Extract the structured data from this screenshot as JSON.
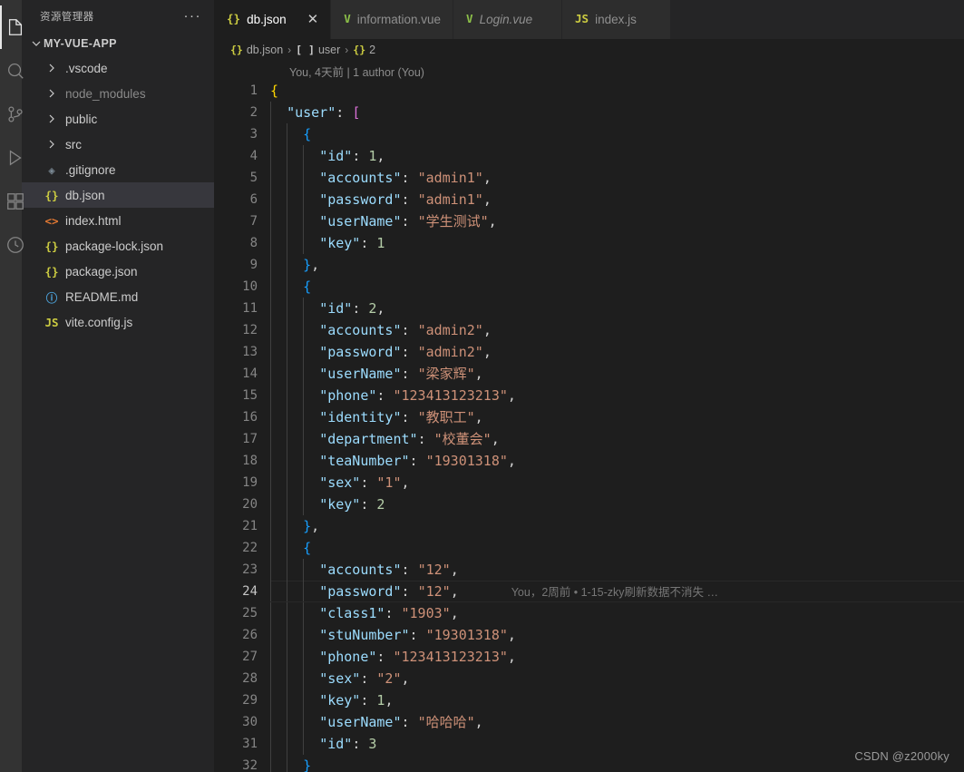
{
  "colors": {
    "editor_bg": "#1e1e1e",
    "sidebar_bg": "#252526",
    "activitybar_bg": "#333333",
    "tab_active_bg": "#1e1e1e",
    "tab_inactive_bg": "#2d2d2d",
    "selection_bg": "#37373d",
    "key": "#9cdcfe",
    "string": "#ce9178",
    "number": "#b5cea8",
    "bracket_gold": "#ffd700",
    "bracket_pink": "#da70d6",
    "bracket_blue": "#179fff"
  },
  "activity_bar": {
    "items": [
      {
        "name": "explorer-icon",
        "active": true
      },
      {
        "name": "search-icon",
        "active": false
      },
      {
        "name": "source-control-icon",
        "active": false
      },
      {
        "name": "run-debug-icon",
        "active": false
      },
      {
        "name": "extensions-icon",
        "active": false
      },
      {
        "name": "remote-explorer-icon",
        "active": false
      }
    ]
  },
  "sidebar": {
    "title": "资源管理器",
    "more_label": "···",
    "root_folder": "MY-VUE-APP",
    "items": [
      {
        "label": ".vscode",
        "icon": "chevron-right",
        "icon_text": "",
        "icon_color": "#cccccc",
        "kind": "folder",
        "dim": false,
        "selected": false
      },
      {
        "label": "node_modules",
        "icon": "chevron-right",
        "icon_text": "",
        "icon_color": "#cccccc",
        "kind": "folder",
        "dim": true,
        "selected": false
      },
      {
        "label": "public",
        "icon": "chevron-right",
        "icon_text": "",
        "icon_color": "#cccccc",
        "kind": "folder",
        "dim": false,
        "selected": false
      },
      {
        "label": "src",
        "icon": "chevron-right",
        "icon_text": "",
        "icon_color": "#cccccc",
        "kind": "folder",
        "dim": false,
        "selected": false
      },
      {
        "label": ".gitignore",
        "icon": "git-icon",
        "icon_text": "◈",
        "icon_color": "#7b8a95",
        "kind": "file",
        "dim": false,
        "selected": false
      },
      {
        "label": "db.json",
        "icon": "json-icon",
        "icon_text": "{}",
        "icon_color": "#cbcb41",
        "kind": "file",
        "dim": false,
        "selected": true
      },
      {
        "label": "index.html",
        "icon": "html-icon",
        "icon_text": "<>",
        "icon_color": "#e37933",
        "kind": "file",
        "dim": false,
        "selected": false
      },
      {
        "label": "package-lock.json",
        "icon": "json-icon",
        "icon_text": "{}",
        "icon_color": "#cbcb41",
        "kind": "file",
        "dim": false,
        "selected": false
      },
      {
        "label": "package.json",
        "icon": "json-icon",
        "icon_text": "{}",
        "icon_color": "#cbcb41",
        "kind": "file",
        "dim": false,
        "selected": false
      },
      {
        "label": "README.md",
        "icon": "info-icon",
        "icon_text": "ⓘ",
        "icon_color": "#4b9fd5",
        "kind": "file",
        "dim": false,
        "selected": false
      },
      {
        "label": "vite.config.js",
        "icon": "js-icon",
        "icon_text": "JS",
        "icon_color": "#cbcb41",
        "kind": "file",
        "dim": false,
        "selected": false
      }
    ]
  },
  "tabs": [
    {
      "label": "db.json",
      "icon_text": "{}",
      "icon_color": "#cbcb41",
      "icon_name": "json-icon",
      "active": true,
      "italic": false,
      "close": "✕"
    },
    {
      "label": "information.vue",
      "icon_text": "V",
      "icon_color": "#8dc149",
      "icon_name": "vue-icon",
      "active": false,
      "italic": false,
      "close": ""
    },
    {
      "label": "Login.vue",
      "icon_text": "V",
      "icon_color": "#8dc149",
      "icon_name": "vue-icon",
      "active": false,
      "italic": true,
      "close": ""
    },
    {
      "label": "index.js",
      "icon_text": "JS",
      "icon_color": "#cbcb41",
      "icon_name": "js-icon",
      "active": false,
      "italic": false,
      "close": ""
    }
  ],
  "breadcrumb": [
    {
      "icon_text": "{}",
      "icon_color": "#cbcb41",
      "icon_name": "json-icon",
      "label": "db.json"
    },
    {
      "icon_text": "[ ]",
      "icon_color": "#cccccc",
      "icon_name": "array-icon",
      "label": "user"
    },
    {
      "icon_text": "{}",
      "icon_color": "#cbcb41",
      "icon_name": "object-icon",
      "label": "2"
    }
  ],
  "breadcrumb_sep": "›",
  "blame_header": "You, 4天前 | 1 author (You)",
  "inline_blame": "You，2周前 • 1-15-zky刷新数据不消失 …",
  "watermark": "CSDN @z2000ky",
  "code": {
    "active_line": 24,
    "lines": [
      {
        "no": 1,
        "tokens": [
          {
            "t": "{",
            "c": "b0"
          }
        ]
      },
      {
        "no": 2,
        "tokens": [
          {
            "t": "  ",
            "c": "p"
          },
          {
            "t": "\"user\"",
            "c": "k"
          },
          {
            "t": ": ",
            "c": "p"
          },
          {
            "t": "[",
            "c": "b1"
          }
        ]
      },
      {
        "no": 3,
        "tokens": [
          {
            "t": "    ",
            "c": "p"
          },
          {
            "t": "{",
            "c": "b2"
          }
        ]
      },
      {
        "no": 4,
        "tokens": [
          {
            "t": "      ",
            "c": "p"
          },
          {
            "t": "\"id\"",
            "c": "k"
          },
          {
            "t": ": ",
            "c": "p"
          },
          {
            "t": "1",
            "c": "n"
          },
          {
            "t": ",",
            "c": "p"
          }
        ]
      },
      {
        "no": 5,
        "tokens": [
          {
            "t": "      ",
            "c": "p"
          },
          {
            "t": "\"accounts\"",
            "c": "k"
          },
          {
            "t": ": ",
            "c": "p"
          },
          {
            "t": "\"admin1\"",
            "c": "s"
          },
          {
            "t": ",",
            "c": "p"
          }
        ]
      },
      {
        "no": 6,
        "tokens": [
          {
            "t": "      ",
            "c": "p"
          },
          {
            "t": "\"password\"",
            "c": "k"
          },
          {
            "t": ": ",
            "c": "p"
          },
          {
            "t": "\"admin1\"",
            "c": "s"
          },
          {
            "t": ",",
            "c": "p"
          }
        ]
      },
      {
        "no": 7,
        "tokens": [
          {
            "t": "      ",
            "c": "p"
          },
          {
            "t": "\"userName\"",
            "c": "k"
          },
          {
            "t": ": ",
            "c": "p"
          },
          {
            "t": "\"学生测试\"",
            "c": "s"
          },
          {
            "t": ",",
            "c": "p"
          }
        ]
      },
      {
        "no": 8,
        "tokens": [
          {
            "t": "      ",
            "c": "p"
          },
          {
            "t": "\"key\"",
            "c": "k"
          },
          {
            "t": ": ",
            "c": "p"
          },
          {
            "t": "1",
            "c": "n"
          }
        ]
      },
      {
        "no": 9,
        "tokens": [
          {
            "t": "    ",
            "c": "p"
          },
          {
            "t": "}",
            "c": "b2"
          },
          {
            "t": ",",
            "c": "p"
          }
        ]
      },
      {
        "no": 10,
        "tokens": [
          {
            "t": "    ",
            "c": "p"
          },
          {
            "t": "{",
            "c": "b2"
          }
        ]
      },
      {
        "no": 11,
        "tokens": [
          {
            "t": "      ",
            "c": "p"
          },
          {
            "t": "\"id\"",
            "c": "k"
          },
          {
            "t": ": ",
            "c": "p"
          },
          {
            "t": "2",
            "c": "n"
          },
          {
            "t": ",",
            "c": "p"
          }
        ]
      },
      {
        "no": 12,
        "tokens": [
          {
            "t": "      ",
            "c": "p"
          },
          {
            "t": "\"accounts\"",
            "c": "k"
          },
          {
            "t": ": ",
            "c": "p"
          },
          {
            "t": "\"admin2\"",
            "c": "s"
          },
          {
            "t": ",",
            "c": "p"
          }
        ]
      },
      {
        "no": 13,
        "tokens": [
          {
            "t": "      ",
            "c": "p"
          },
          {
            "t": "\"password\"",
            "c": "k"
          },
          {
            "t": ": ",
            "c": "p"
          },
          {
            "t": "\"admin2\"",
            "c": "s"
          },
          {
            "t": ",",
            "c": "p"
          }
        ]
      },
      {
        "no": 14,
        "tokens": [
          {
            "t": "      ",
            "c": "p"
          },
          {
            "t": "\"userName\"",
            "c": "k"
          },
          {
            "t": ": ",
            "c": "p"
          },
          {
            "t": "\"梁家辉\"",
            "c": "s"
          },
          {
            "t": ",",
            "c": "p"
          }
        ]
      },
      {
        "no": 15,
        "tokens": [
          {
            "t": "      ",
            "c": "p"
          },
          {
            "t": "\"phone\"",
            "c": "k"
          },
          {
            "t": ": ",
            "c": "p"
          },
          {
            "t": "\"123413123213\"",
            "c": "s"
          },
          {
            "t": ",",
            "c": "p"
          }
        ]
      },
      {
        "no": 16,
        "tokens": [
          {
            "t": "      ",
            "c": "p"
          },
          {
            "t": "\"identity\"",
            "c": "k"
          },
          {
            "t": ": ",
            "c": "p"
          },
          {
            "t": "\"教职工\"",
            "c": "s"
          },
          {
            "t": ",",
            "c": "p"
          }
        ]
      },
      {
        "no": 17,
        "tokens": [
          {
            "t": "      ",
            "c": "p"
          },
          {
            "t": "\"department\"",
            "c": "k"
          },
          {
            "t": ": ",
            "c": "p"
          },
          {
            "t": "\"校董会\"",
            "c": "s"
          },
          {
            "t": ",",
            "c": "p"
          }
        ]
      },
      {
        "no": 18,
        "tokens": [
          {
            "t": "      ",
            "c": "p"
          },
          {
            "t": "\"teaNumber\"",
            "c": "k"
          },
          {
            "t": ": ",
            "c": "p"
          },
          {
            "t": "\"19301318\"",
            "c": "s"
          },
          {
            "t": ",",
            "c": "p"
          }
        ]
      },
      {
        "no": 19,
        "tokens": [
          {
            "t": "      ",
            "c": "p"
          },
          {
            "t": "\"sex\"",
            "c": "k"
          },
          {
            "t": ": ",
            "c": "p"
          },
          {
            "t": "\"1\"",
            "c": "s"
          },
          {
            "t": ",",
            "c": "p"
          }
        ]
      },
      {
        "no": 20,
        "tokens": [
          {
            "t": "      ",
            "c": "p"
          },
          {
            "t": "\"key\"",
            "c": "k"
          },
          {
            "t": ": ",
            "c": "p"
          },
          {
            "t": "2",
            "c": "n"
          }
        ]
      },
      {
        "no": 21,
        "tokens": [
          {
            "t": "    ",
            "c": "p"
          },
          {
            "t": "}",
            "c": "b2"
          },
          {
            "t": ",",
            "c": "p"
          }
        ]
      },
      {
        "no": 22,
        "tokens": [
          {
            "t": "    ",
            "c": "p"
          },
          {
            "t": "{",
            "c": "b2"
          }
        ]
      },
      {
        "no": 23,
        "tokens": [
          {
            "t": "      ",
            "c": "p"
          },
          {
            "t": "\"accounts\"",
            "c": "k"
          },
          {
            "t": ": ",
            "c": "p"
          },
          {
            "t": "\"12\"",
            "c": "s"
          },
          {
            "t": ",",
            "c": "p"
          }
        ]
      },
      {
        "no": 24,
        "tokens": [
          {
            "t": "      ",
            "c": "p"
          },
          {
            "t": "\"password\"",
            "c": "k"
          },
          {
            "t": ": ",
            "c": "p"
          },
          {
            "t": "\"12\"",
            "c": "s"
          },
          {
            "t": ",",
            "c": "p"
          }
        ]
      },
      {
        "no": 25,
        "tokens": [
          {
            "t": "      ",
            "c": "p"
          },
          {
            "t": "\"class1\"",
            "c": "k"
          },
          {
            "t": ": ",
            "c": "p"
          },
          {
            "t": "\"1903\"",
            "c": "s"
          },
          {
            "t": ",",
            "c": "p"
          }
        ]
      },
      {
        "no": 26,
        "tokens": [
          {
            "t": "      ",
            "c": "p"
          },
          {
            "t": "\"stuNumber\"",
            "c": "k"
          },
          {
            "t": ": ",
            "c": "p"
          },
          {
            "t": "\"19301318\"",
            "c": "s"
          },
          {
            "t": ",",
            "c": "p"
          }
        ]
      },
      {
        "no": 27,
        "tokens": [
          {
            "t": "      ",
            "c": "p"
          },
          {
            "t": "\"phone\"",
            "c": "k"
          },
          {
            "t": ": ",
            "c": "p"
          },
          {
            "t": "\"123413123213\"",
            "c": "s"
          },
          {
            "t": ",",
            "c": "p"
          }
        ]
      },
      {
        "no": 28,
        "tokens": [
          {
            "t": "      ",
            "c": "p"
          },
          {
            "t": "\"sex\"",
            "c": "k"
          },
          {
            "t": ": ",
            "c": "p"
          },
          {
            "t": "\"2\"",
            "c": "s"
          },
          {
            "t": ",",
            "c": "p"
          }
        ]
      },
      {
        "no": 29,
        "tokens": [
          {
            "t": "      ",
            "c": "p"
          },
          {
            "t": "\"key\"",
            "c": "k"
          },
          {
            "t": ": ",
            "c": "p"
          },
          {
            "t": "1",
            "c": "n"
          },
          {
            "t": ",",
            "c": "p"
          }
        ]
      },
      {
        "no": 30,
        "tokens": [
          {
            "t": "      ",
            "c": "p"
          },
          {
            "t": "\"userName\"",
            "c": "k"
          },
          {
            "t": ": ",
            "c": "p"
          },
          {
            "t": "\"哈哈哈\"",
            "c": "s"
          },
          {
            "t": ",",
            "c": "p"
          }
        ]
      },
      {
        "no": 31,
        "tokens": [
          {
            "t": "      ",
            "c": "p"
          },
          {
            "t": "\"id\"",
            "c": "k"
          },
          {
            "t": ": ",
            "c": "p"
          },
          {
            "t": "3",
            "c": "n"
          }
        ]
      },
      {
        "no": 32,
        "tokens": [
          {
            "t": "    ",
            "c": "p"
          },
          {
            "t": "}",
            "c": "b2"
          }
        ]
      }
    ]
  }
}
